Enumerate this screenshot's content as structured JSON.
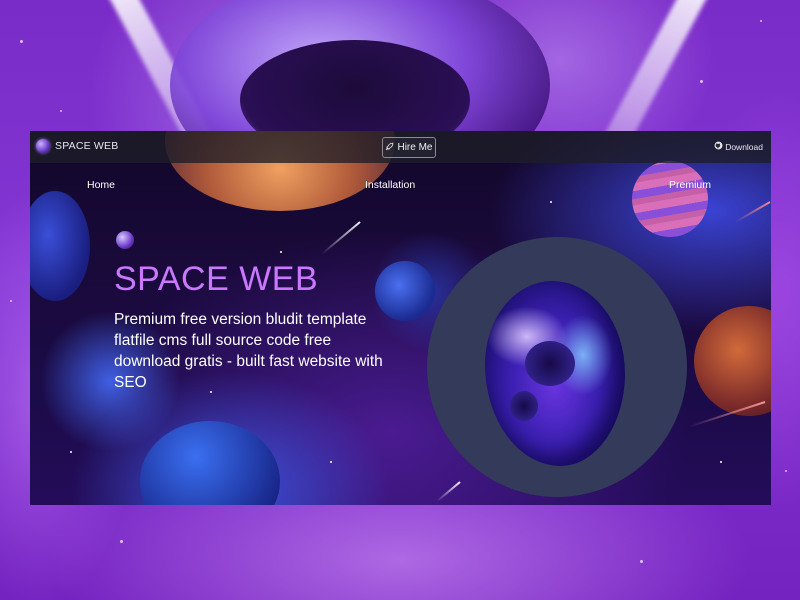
{
  "site": {
    "brand": "SPACE WEB",
    "header": {
      "hire_label": "Hire Me",
      "download_label": "Download"
    },
    "nav": [
      {
        "label": "Home"
      },
      {
        "label": "Installation"
      },
      {
        "label": "Premium"
      }
    ],
    "hero": {
      "title": "SPACE WEB",
      "subtitle": "Premium free version bludit template flatfile cms full source code free download gratis - built fast website with SEO"
    }
  },
  "colors": {
    "accent": "#c978ff",
    "header_bg": "#1e1e28",
    "outer_bg": "#7a2cc8"
  },
  "icons": {
    "logo": "planet-logo-icon",
    "hire": "rocket-icon",
    "download": "github-icon"
  }
}
